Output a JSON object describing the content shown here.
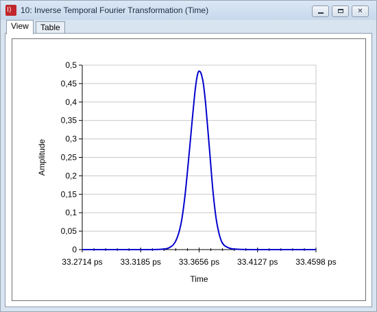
{
  "window": {
    "title": "10: Inverse Temporal Fourier Transformation (Time)",
    "icon": "app-logo-icon",
    "controls": [
      "minimize-icon",
      "maximize-icon",
      "close-icon"
    ]
  },
  "tabs": [
    {
      "label": "View",
      "active": true
    },
    {
      "label": "Table",
      "active": false
    }
  ],
  "chart_data": {
    "type": "line",
    "xlabel": "Time",
    "ylabel": "Amplitude",
    "xlim": [
      33.2714,
      33.4598
    ],
    "ylim": [
      0,
      0.5
    ],
    "x_tick_labels": [
      "33.2714 ps",
      "33.3185 ps",
      "33.3656 ps",
      "33.4127 ps",
      "33.4598 ps"
    ],
    "y_tick_labels": [
      "0",
      "0,05",
      "0,1",
      "0,15",
      "0,2",
      "0,25",
      "0,3",
      "0,35",
      "0,4",
      "0,45",
      "0,5"
    ],
    "grid": "horizontal",
    "line_color": "#0000cc",
    "series": [
      {
        "x": [
          33.2714,
          33.3185,
          33.335,
          33.342,
          33.347,
          33.351,
          33.354,
          33.357,
          33.36,
          33.362,
          33.3635,
          33.3645,
          33.365,
          33.3656,
          33.3665,
          33.3675,
          33.369,
          33.371,
          33.374,
          33.377,
          33.38,
          33.384,
          33.39,
          33.397,
          33.4127,
          33.4598
        ],
        "y": [
          0,
          0,
          0.001,
          0.006,
          0.025,
          0.07,
          0.14,
          0.24,
          0.35,
          0.42,
          0.46,
          0.477,
          0.482,
          0.484,
          0.482,
          0.474,
          0.45,
          0.39,
          0.27,
          0.15,
          0.07,
          0.02,
          0.004,
          0.001,
          0,
          0
        ]
      }
    ]
  }
}
